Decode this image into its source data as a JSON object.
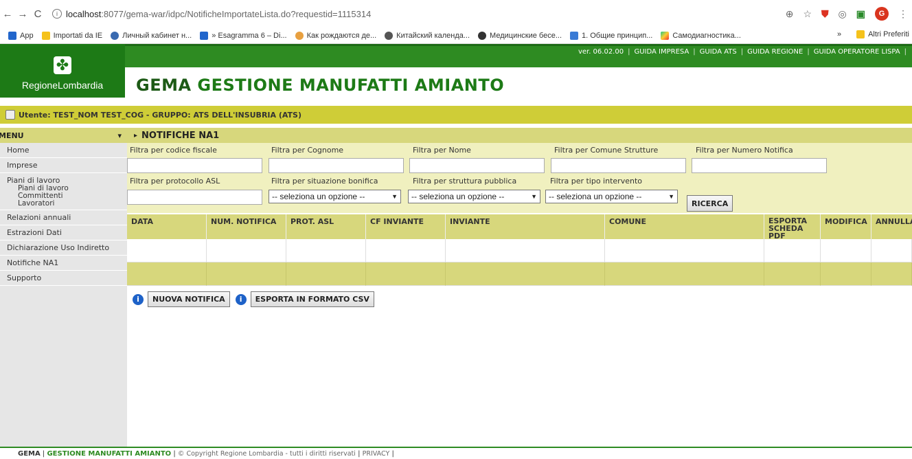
{
  "browser": {
    "url_host": "localhost",
    "url_path": ":8077/gema-war/idpc/NotificheImportateLista.do?requestid=1115314",
    "profile_initial": "G",
    "bookmarks": [
      "App",
      "Importati da IE",
      "Личный кабинет н...",
      "» Esagramma 6 – Di...",
      "Как рождаются де...",
      "Китайский календа...",
      "Медицинские бесе...",
      "1. Общие принцип...",
      "Самодиагностика..."
    ],
    "bookmarks_more": "»",
    "other_bookmarks": "Altri Preferiti"
  },
  "header": {
    "logo_text": "RegioneLombardia",
    "title_1": "GEMA",
    "title_2": "GESTIONE MANUFATTI AMIANTO",
    "version": "ver. 06.02.00",
    "links": [
      "GUIDA IMPRESA",
      "GUIDA ATS",
      "GUIDA REGIONE",
      "GUIDA OPERATORE LISPA"
    ]
  },
  "user": {
    "text": "Utente: TEST_NOM TEST_COG - GRUPPO: ATS DELL'INSUBRIA (ATS)"
  },
  "sidebar": {
    "header": "MENU",
    "items": [
      "Home",
      "Imprese",
      "Piani di lavoro",
      "Relazioni annuali",
      "Estrazioni Dati",
      "Dichiarazione Uso Indiretto",
      "Notifiche NA1",
      "Supporto"
    ],
    "sub_items": [
      "Piani di lavoro",
      "Committenti",
      "Lavoratori"
    ]
  },
  "main": {
    "section_title": "NOTIFICHE NA1",
    "filters": {
      "cf": "Filtra per codice fiscale",
      "cognome": "Filtra per Cognome",
      "nome": "Filtra per Nome",
      "comune": "Filtra per Comune Strutture",
      "numero": "Filtra per Numero Notifica",
      "protocollo": "Filtra per protocollo ASL",
      "situazione": "Filtra per situazione bonifica",
      "pubblica": "Filtra per struttura pubblica",
      "tipo": "Filtra per tipo intervento",
      "select_placeholder": "-- seleziona un opzione --",
      "search_button": "RICERCA"
    },
    "table": {
      "columns": [
        "DATA",
        "NUM. NOTIFICA",
        "PROT. ASL",
        "CF INVIANTE",
        "INVIANTE",
        "COMUNE",
        "ESPORTA SCHEDA PDF",
        "MODIFICA",
        "ANNULLA"
      ]
    },
    "actions": {
      "new_button": "NUOVA NOTIFICA",
      "export_button": "ESPORTA IN FORMATO CSV"
    }
  },
  "footer": {
    "gema": "GEMA",
    "full": "GESTIONE MANUFATTI AMIANTO",
    "copyright": "© Copyright Regione Lombardia - tutti i diritti riservati",
    "privacy": "PRIVACY"
  }
}
